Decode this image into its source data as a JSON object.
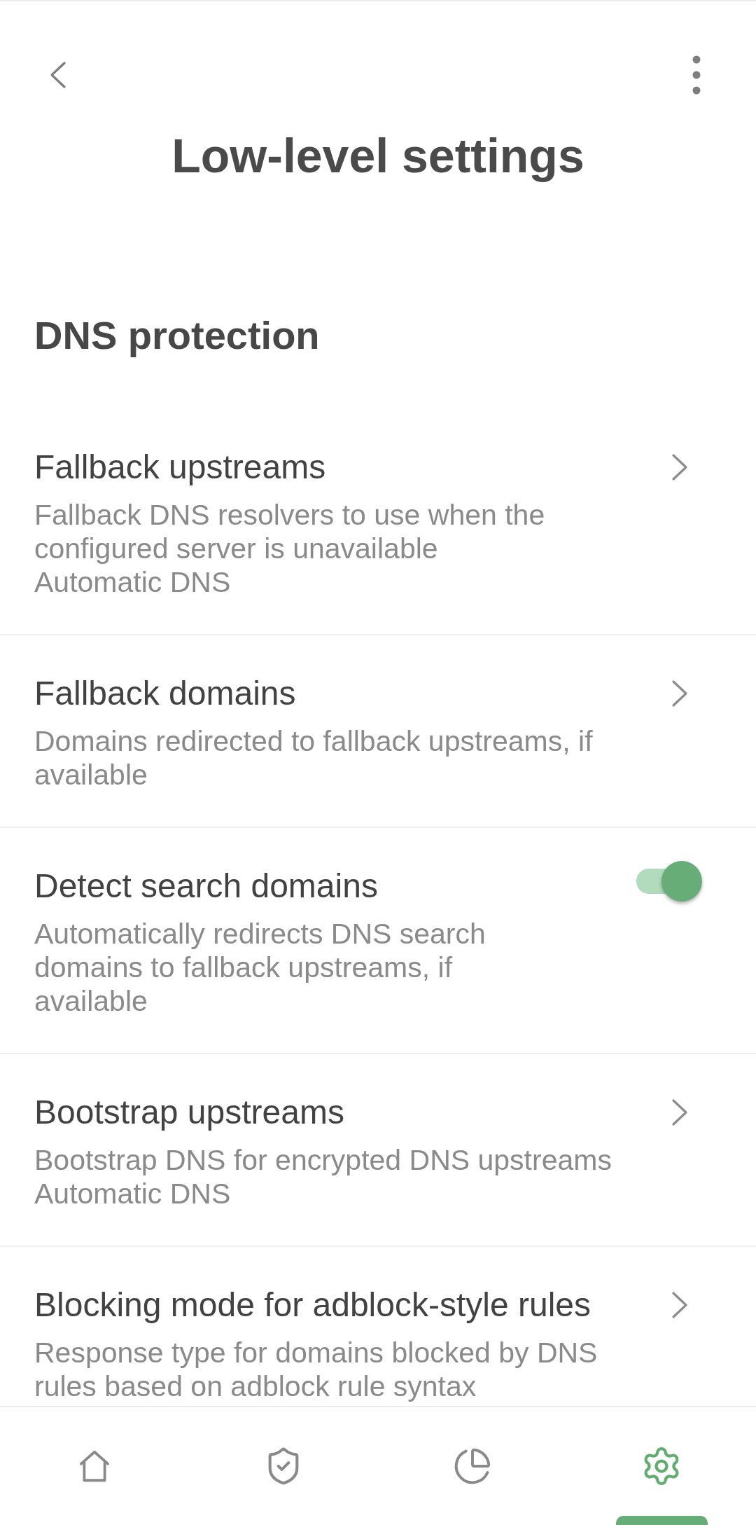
{
  "header": {
    "title": "Low-level settings"
  },
  "section": {
    "title": "DNS protection"
  },
  "settings": [
    {
      "kind": "link",
      "title": "Fallback upstreams",
      "description": "Fallback DNS resolvers to use when the configured server is unavailable",
      "value": "Automatic DNS"
    },
    {
      "kind": "link",
      "title": "Fallback domains",
      "description": "Domains redirected to fallback upstreams, if available"
    },
    {
      "kind": "toggle",
      "title": "Detect search domains",
      "description": "Automatically redirects DNS search domains to fallback upstreams, if available",
      "on": true
    },
    {
      "kind": "link",
      "title": "Bootstrap upstreams",
      "description": "Bootstrap DNS for encrypted DNS upstreams",
      "value": "Automatic DNS"
    },
    {
      "kind": "link",
      "title": "Blocking mode for adblock-style rules",
      "description": "Response type for domains blocked by DNS rules based on adblock rule syntax"
    }
  ],
  "bottom_nav": [
    {
      "selected": false
    },
    {
      "selected": false
    },
    {
      "selected": false
    },
    {
      "selected": true
    }
  ]
}
